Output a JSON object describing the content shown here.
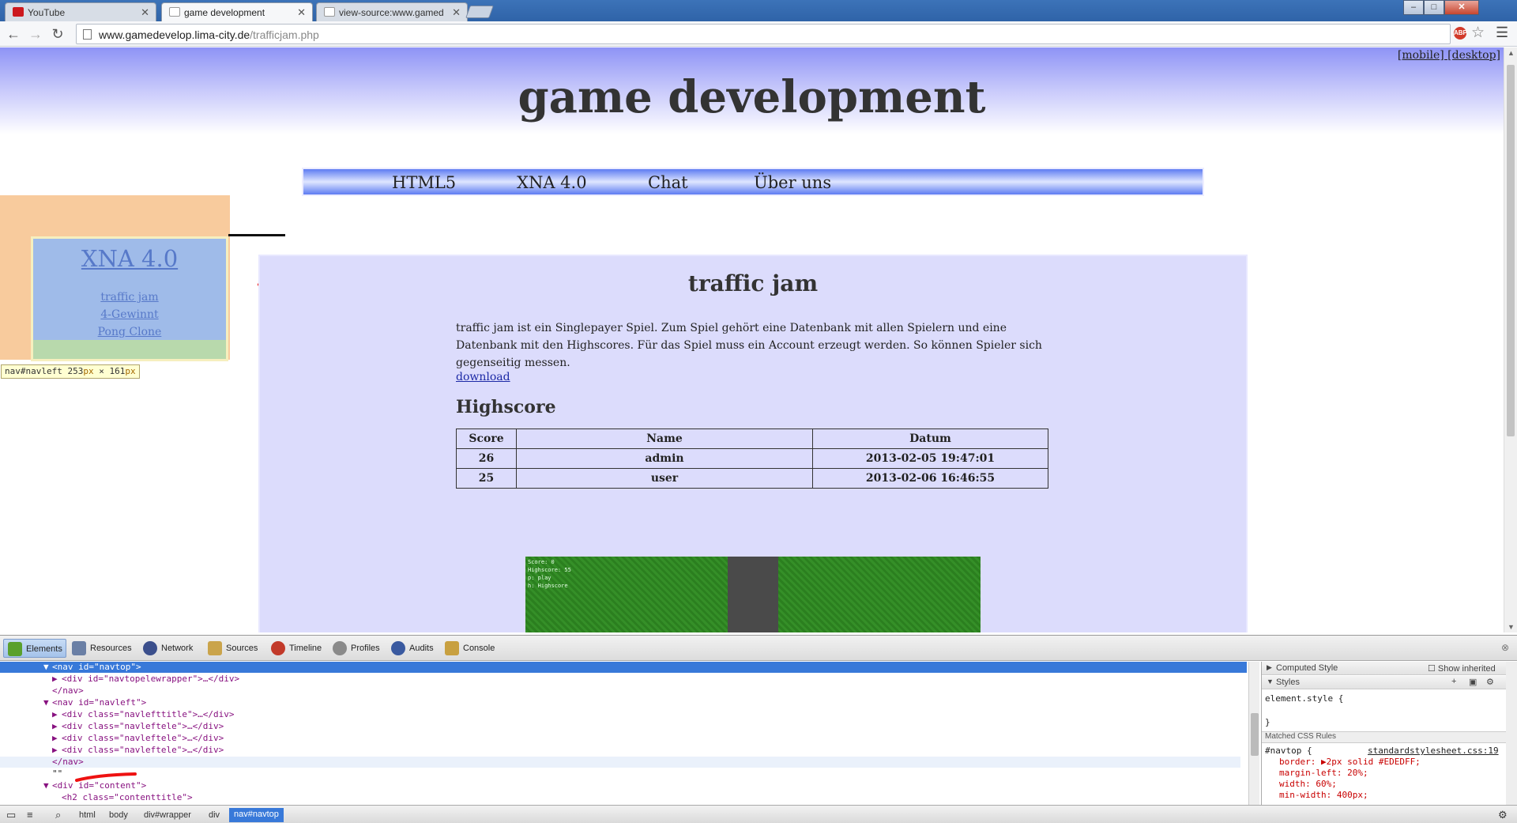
{
  "browser": {
    "tabs": [
      {
        "title": "YouTube",
        "favicon_color": "#cc181e"
      },
      {
        "title": "game development",
        "favicon_color": "#ffffff"
      },
      {
        "title": "view-source:www.gamed",
        "favicon_color": "#ffffff"
      }
    ],
    "address": {
      "host": "www.gamedevelop.lima-city.de",
      "path": "/trafficjam.php"
    },
    "abp_badge": "ABP",
    "window_buttons": [
      "–",
      "□",
      "✕"
    ]
  },
  "page": {
    "mode_switch": "[mobile] [desktop]",
    "site_title": "game development",
    "navtop": [
      "HTML5",
      "XNA 4.0",
      "Chat",
      "Über uns"
    ],
    "navleft": {
      "title": "XNA 4.0",
      "links": [
        "traffic jam",
        "4-Gewinnt",
        "Pong Clone"
      ]
    },
    "inspect_tooltip": {
      "selector": "nav#navleft",
      "width": "253",
      "height": "161",
      "unit": "px",
      "times": "×"
    },
    "content": {
      "title": "traffic jam",
      "description": "traffic jam ist ein Singlepayer Spiel. Zum Spiel gehört eine Datenbank mit allen Spielern und eine Datenbank mit den Highscores. Für das Spiel muss ein Account erzeugt werden. So können Spieler sich gegenseitig messen.",
      "download": "download",
      "highscore_title": "Highscore",
      "table": {
        "headers": [
          "Score",
          "Name",
          "Datum"
        ],
        "rows": [
          [
            "26",
            "admin",
            "2013-02-05 19:47:01"
          ],
          [
            "25",
            "user",
            "2013-02-06 16:46:55"
          ]
        ]
      },
      "game_hud": "Score: 0\nHighscore: 55\np: play\nh: Highscore"
    }
  },
  "devtools": {
    "tabs": [
      "Elements",
      "Resources",
      "Network",
      "Sources",
      "Timeline",
      "Profiles",
      "Audits",
      "Console"
    ],
    "tab_icon_colors": [
      "#5aa02c",
      "#6a7fa5",
      "#3b4f8c",
      "#caa44b",
      "#c23a2a",
      "#8a8a8a",
      "#3a5aa0",
      "#c8a040"
    ],
    "dom_lines": [
      {
        "indent": 48,
        "arrow": "▼",
        "text": "<nav id=\"navtop\">",
        "selected": true
      },
      {
        "indent": 58,
        "arrow": "▶",
        "text": "<div id=\"navtopelewrapper\">…</div>"
      },
      {
        "indent": 54,
        "arrow": "",
        "text": "</nav>"
      },
      {
        "indent": 48,
        "arrow": "▼",
        "text": "<nav id=\"navleft\">"
      },
      {
        "indent": 58,
        "arrow": "▶",
        "text": "<div class=\"navlefttitle\">…</div>"
      },
      {
        "indent": 58,
        "arrow": "▶",
        "text": "<div class=\"navleftele\">…</div>"
      },
      {
        "indent": 58,
        "arrow": "▶",
        "text": "<div class=\"navleftele\">…</div>"
      },
      {
        "indent": 58,
        "arrow": "▶",
        "text": "<div class=\"navleftele\">…</div>"
      },
      {
        "indent": 54,
        "arrow": "",
        "text": "</nav>",
        "hover": true
      },
      {
        "indent": 54,
        "arrow": "",
        "text": "\"\""
      },
      {
        "indent": 48,
        "arrow": "▼",
        "text": "<div id=\"content\">"
      },
      {
        "indent": 64,
        "arrow": "",
        "text": "<h2 class=\"contenttitle\">"
      }
    ],
    "sidebar": {
      "computed_style": "Computed Style",
      "show_inherited": "Show inherited",
      "styles": "Styles",
      "element_style": "element.style {",
      "close_brace": "}",
      "matched_rules": "Matched CSS Rules",
      "rule_selector": "#navtop {",
      "rule_source": "standardstylesheet.css:19",
      "props": [
        "border: ▶2px solid  #EDEDFF;",
        "margin-left: 20%;",
        "width: 60%;",
        "min-width: 400px;"
      ]
    },
    "breadcrumbs": [
      "html",
      "body",
      "div#wrapper",
      "div",
      "nav#navtop"
    ]
  }
}
